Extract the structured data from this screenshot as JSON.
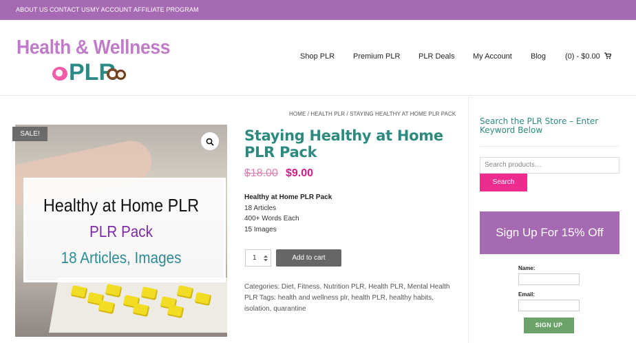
{
  "topbar": {
    "links": [
      "ABOUT US",
      "CONTACT US",
      "MY ACCOUNT",
      "AFFILIATE PROGRAM"
    ]
  },
  "logo": {
    "line1": "Health & Wellness",
    "line2": "PLR"
  },
  "nav": {
    "items": [
      "Shop PLR",
      "Premium PLR",
      "PLR Deals",
      "My Account",
      "Blog"
    ],
    "cart": "(0) - $0.00"
  },
  "breadcrumb": "HOME / HEALTH PLR / STAYING HEALTHY AT HOME PLR PACK",
  "product_image": {
    "sale_badge": "SALE!",
    "line1": "Healthy at Home PLR",
    "line2": "PLR Pack",
    "line3": "18 Articles, Images"
  },
  "product": {
    "title": "Staying Healthy at Home PLR Pack",
    "price_old": "$18.00",
    "price_new": "$9.00",
    "desc_title": "Healthy at Home PLR Pack",
    "desc_lines": [
      "18 Articles",
      "400+ Words Each",
      "15 Images"
    ],
    "quantity": "1",
    "add_to_cart": "Add to cart",
    "meta": "Categories: Diet, Fitness, Nutrition PLR, Health PLR, Mental Health PLR Tags: health and wellness plr, health PLR, healthy habits, isolation, quarantine"
  },
  "sidebar": {
    "search_title": "Search the PLR Store – Enter Keyword Below",
    "search_placeholder": "Search products…",
    "search_button": "Search",
    "signup_banner": "Sign Up For 15% Off",
    "name_label": "Name:",
    "email_label": "Email:",
    "signup_button": "SIGN UP"
  }
}
